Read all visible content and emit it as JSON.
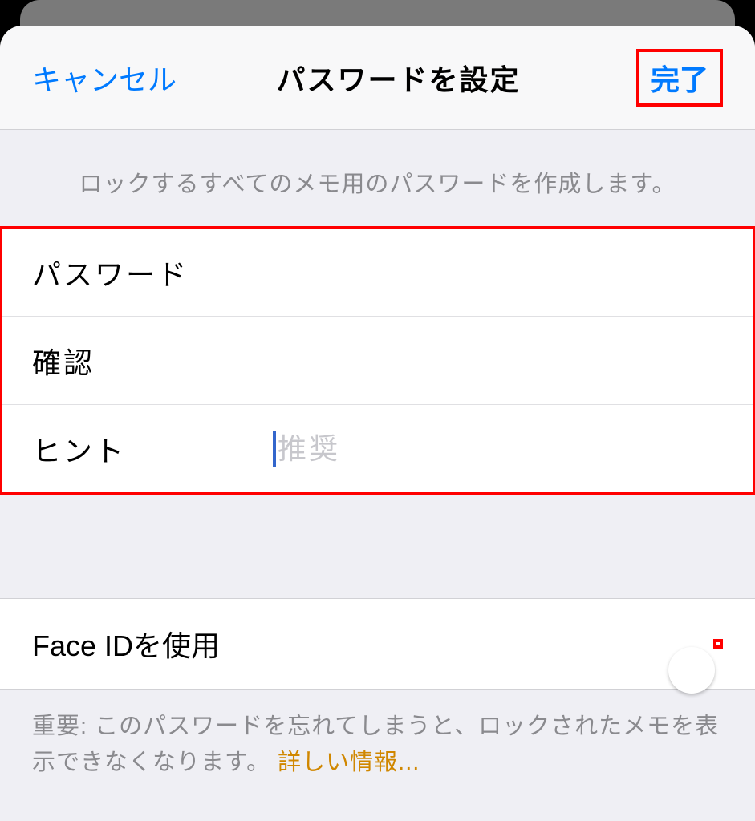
{
  "navbar": {
    "cancel": "キャンセル",
    "title": "パスワードを設定",
    "done": "完了"
  },
  "header_note": "ロックするすべてのメモ用のパスワードを作成します。",
  "fields": {
    "password_label": "パスワード",
    "confirm_label": "確認",
    "hint_label": "ヒント",
    "hint_placeholder": "推奨"
  },
  "faceid": {
    "label": "Face IDを使用",
    "enabled": true
  },
  "footer": {
    "text": "重要: このパスワードを忘れてしまうと、ロックされたメモを表示できなくなります。 ",
    "link": "詳しい情報..."
  },
  "colors": {
    "tint": "#007aff",
    "switch_on": "#34c759",
    "highlight_border": "#ff0000",
    "link": "#d08700"
  }
}
